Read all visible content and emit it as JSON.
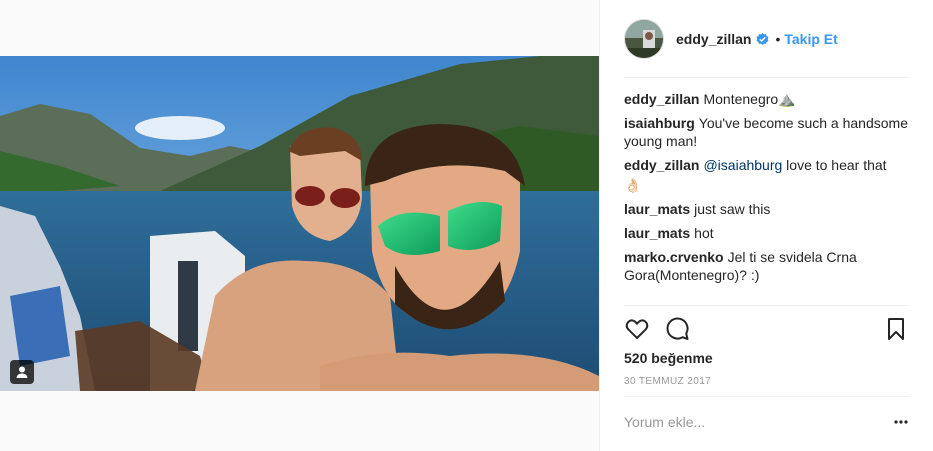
{
  "post": {
    "username": "eddy_zillan",
    "dot": "•",
    "follow_label": "Takip Et",
    "likes": "520 beğenme",
    "date": "30 TEMMUZ 2017",
    "comment_placeholder": "Yorum ekle..."
  },
  "comments": [
    {
      "user": "eddy_zillan",
      "text": "Montenegro⛰️"
    },
    {
      "user": "isaiahburg",
      "text": "You've become such a handsome young man!"
    },
    {
      "user": "eddy_zillan",
      "mention": "@isaiahburg",
      "text": "love to hear that",
      "emoji": "👌🏻"
    },
    {
      "user": "laur_mats",
      "text": "just saw this"
    },
    {
      "user": "laur_mats",
      "text": "hot"
    },
    {
      "user": "marko.crvenko",
      "text": "Jel ti se svidela Crna Gora(Montenegro)? :)"
    }
  ],
  "icons": {
    "verified": "verified-badge-icon",
    "like": "heart-icon",
    "comment": "comment-bubble-icon",
    "save": "bookmark-icon",
    "more": "more-options-icon",
    "user_tag": "user-tag-icon"
  },
  "colors": {
    "accent": "#3897f0",
    "mention": "#003569",
    "muted": "#999999",
    "text": "#262626"
  }
}
